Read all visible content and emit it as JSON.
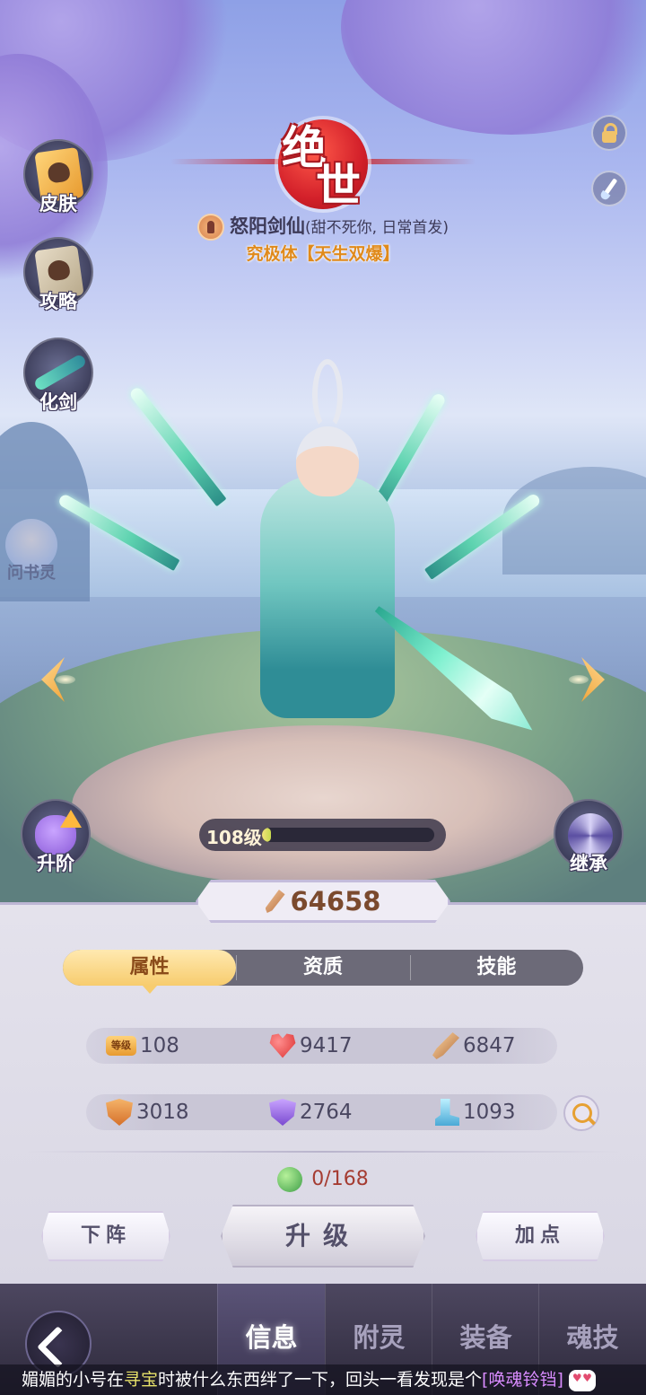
{
  "hero": {
    "title_char_1": "绝",
    "title_char_2": "世",
    "name": "怒阳剑仙",
    "note": "(甜不死你, 日常首发)",
    "subtitle": "究极体【天生双爆】",
    "level_label": "108级",
    "level_progress": 0.05,
    "power": "64658"
  },
  "side_left": [
    {
      "label": "皮肤",
      "icon": "skin-card-icon"
    },
    {
      "label": "攻略",
      "icon": "guide-book-icon"
    },
    {
      "label": "化剑",
      "icon": "sword-transform-icon"
    }
  ],
  "npc_label": "问书灵",
  "upgrade_rank_label": "升阶",
  "inherit_label": "继承",
  "tabs": [
    "属性",
    "资质",
    "技能"
  ],
  "stats": {
    "level_tag": "等级",
    "level": "108",
    "hp": "9417",
    "attack": "6847",
    "defense": "3018",
    "magic_defense": "2764",
    "speed": "1093"
  },
  "exp": "0/168",
  "buttons": {
    "off_lineup": "下阵",
    "level_up": "升级",
    "add_points": "加点"
  },
  "nav": [
    "信息",
    "附灵",
    "装备",
    "魂技"
  ],
  "ticker": {
    "part1": "媚媚的小号在",
    "highlight": "寻宝",
    "part2": "时被什么东西绊了一下，回头一看发现是个",
    "item": "[唤魂铃铛]"
  },
  "colors": {
    "accent_gold": "#f7cc6e",
    "emblem_red": "#d3202a",
    "power_text": "#7b4a2e",
    "exp_text": "#a53c32"
  }
}
